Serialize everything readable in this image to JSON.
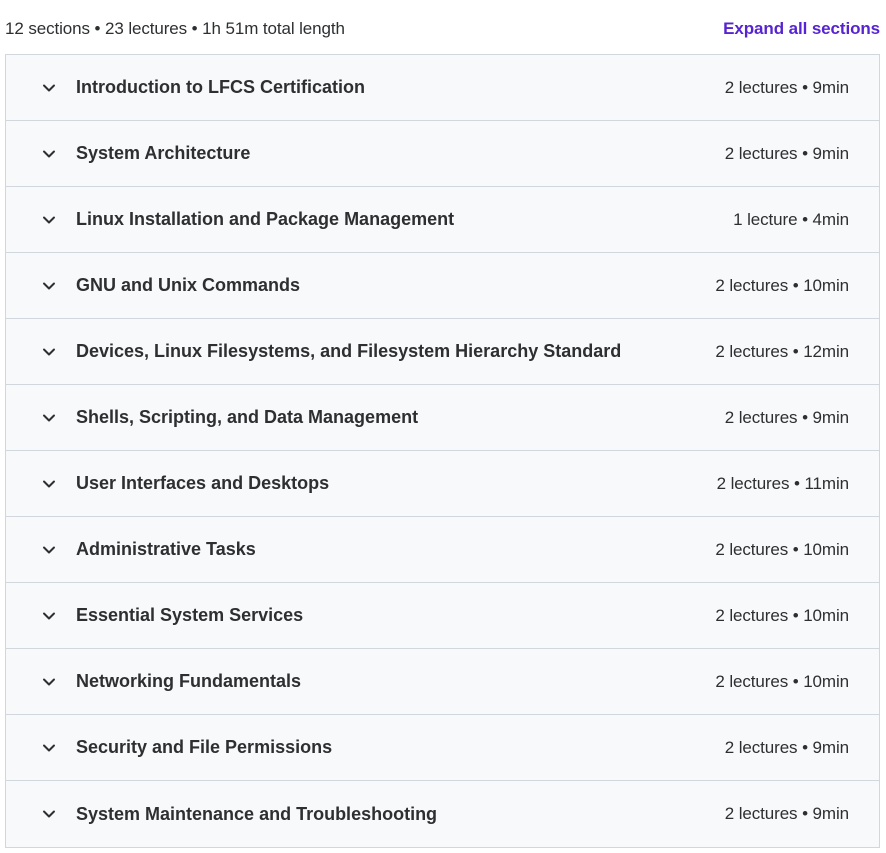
{
  "summary": {
    "text": "12 sections • 23 lectures • 1h 51m total length",
    "expand_label": "Expand all sections"
  },
  "colors": {
    "link": "#5624d0",
    "section_bg": "#f7f9fa",
    "border": "#d1d7dc",
    "text": "#2d2f31"
  },
  "icons": {
    "section_toggle": "chevron-down-icon"
  },
  "sections": [
    {
      "title": "Introduction to LFCS Certification",
      "meta": "2 lectures • 9min"
    },
    {
      "title": "System Architecture",
      "meta": "2 lectures • 9min"
    },
    {
      "title": "Linux Installation and Package Management",
      "meta": "1 lecture • 4min"
    },
    {
      "title": "GNU and Unix Commands",
      "meta": "2 lectures • 10min"
    },
    {
      "title": "Devices, Linux Filesystems, and Filesystem Hierarchy Standard",
      "meta": "2 lectures • 12min"
    },
    {
      "title": "Shells, Scripting, and Data Management",
      "meta": "2 lectures • 9min"
    },
    {
      "title": "User Interfaces and Desktops",
      "meta": "2 lectures • 11min"
    },
    {
      "title": "Administrative Tasks",
      "meta": "2 lectures • 10min"
    },
    {
      "title": "Essential System Services",
      "meta": "2 lectures • 10min"
    },
    {
      "title": "Networking Fundamentals",
      "meta": "2 lectures • 10min"
    },
    {
      "title": "Security and File Permissions",
      "meta": "2 lectures • 9min"
    },
    {
      "title": "System Maintenance and Troubleshooting",
      "meta": "2 lectures • 9min"
    }
  ]
}
